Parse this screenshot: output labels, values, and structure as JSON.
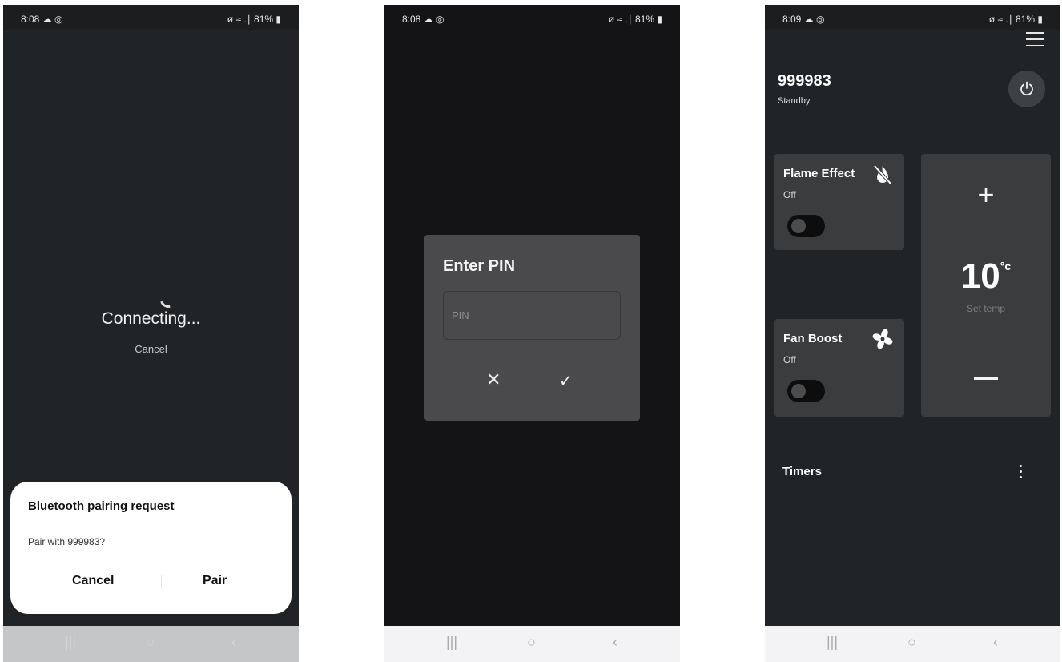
{
  "screens": [
    {
      "status": {
        "time": "8:08 ☁ ◎",
        "right": "ø ≈ .∣ 81% ▮"
      },
      "connecting_text": "Connecting...",
      "cancel_link": "Cancel",
      "bt_dialog": {
        "title": "Bluetooth pairing request",
        "message": "Pair with 999983?",
        "cancel_label": "Cancel",
        "pair_label": "Pair"
      },
      "nav": {
        "recent": "|||",
        "home": "○",
        "back": "‹"
      }
    },
    {
      "status": {
        "time": "8:08 ☁ ◎",
        "right": "ø ≈ .∣ 81% ▮"
      },
      "pin_dialog": {
        "title": "Enter PIN",
        "input_placeholder": "PIN",
        "cancel_glyph": "✕",
        "confirm_glyph": "✓"
      },
      "nav": {
        "recent": "|||",
        "home": "○",
        "back": "‹"
      }
    },
    {
      "status": {
        "time": "8:09 ☁ ◎",
        "right": "ø ≈ .∣ 81% ▮"
      },
      "device": {
        "name": "999983",
        "state": "Standby"
      },
      "flame": {
        "title": "Flame Effect",
        "state": "Off",
        "icon": "flame-off-icon"
      },
      "fan": {
        "title": "Fan Boost",
        "state": "Off",
        "icon": "fan-icon"
      },
      "temp": {
        "plus": "+",
        "value": "10",
        "unit": "°c",
        "label": "Set temp"
      },
      "timers_label": "Timers",
      "nav": {
        "recent": "|||",
        "home": "○",
        "back": "‹"
      }
    }
  ]
}
